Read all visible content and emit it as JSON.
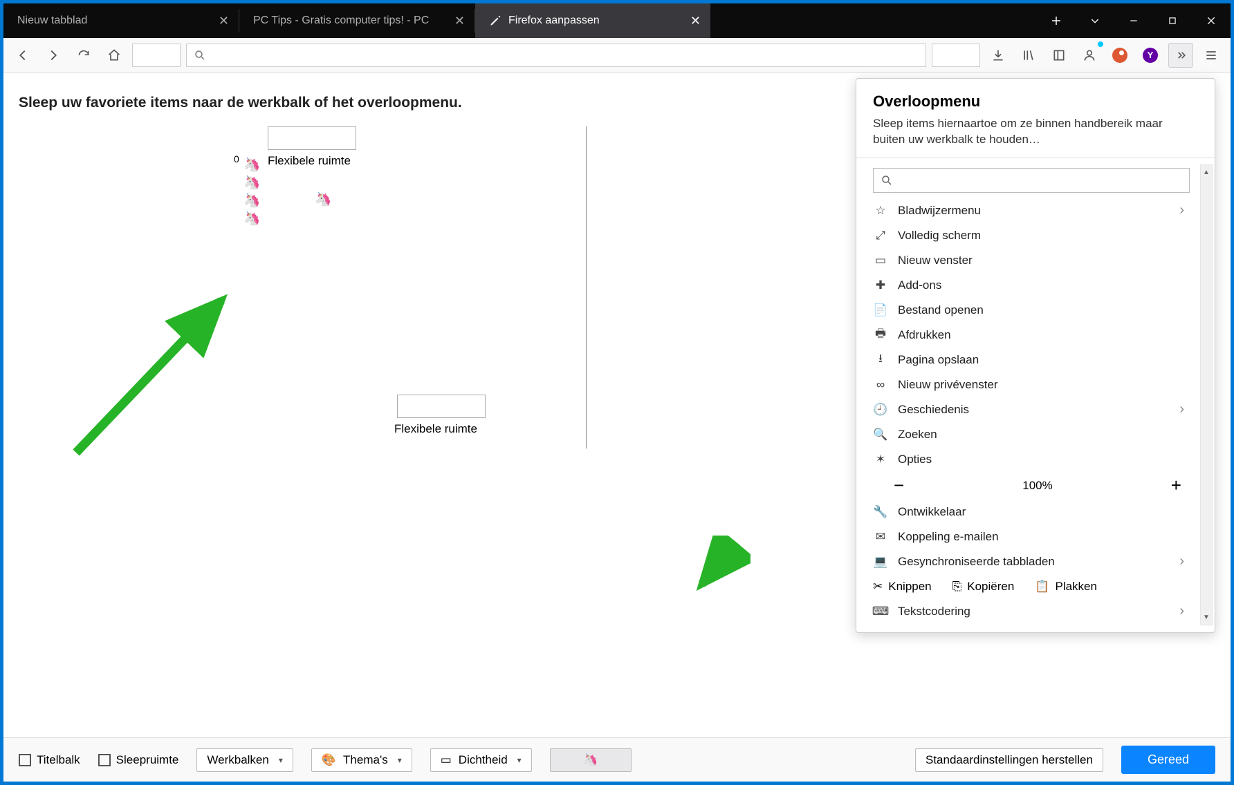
{
  "tabs": [
    {
      "label": "Nieuw tabblad"
    },
    {
      "label": "PC Tips - Gratis computer tips! - PC"
    },
    {
      "label": "Firefox aanpassen"
    }
  ],
  "instruction": "Sleep uw favoriete items naar de werkbalk of het overloopmenu.",
  "palette": {
    "flex1": "Flexibele ruimte",
    "flex2": "Flexibele ruimte",
    "zero": "0"
  },
  "panel": {
    "title": "Overloopmenu",
    "desc": "Sleep items hiernaartoe om ze binnen handbereik maar buiten uw werkbalk te houden…",
    "items": {
      "bookmarks": "Bladwijzermenu",
      "fullscreen": "Volledig scherm",
      "newwindow": "Nieuw venster",
      "addons": "Add-ons",
      "openfile": "Bestand openen",
      "print": "Afdrukken",
      "savepage": "Pagina opslaan",
      "private": "Nieuw privévenster",
      "history": "Geschiedenis",
      "search": "Zoeken",
      "options": "Opties",
      "zoom": "100%",
      "developer": "Ontwikkelaar",
      "email": "Koppeling e-mailen",
      "synced": "Gesynchroniseerde tabbladen",
      "cut": "Knippen",
      "copy": "Kopiëren",
      "paste": "Plakken",
      "encoding": "Tekstcodering"
    }
  },
  "footer": {
    "titelbalk": "Titelbalk",
    "sleepruimte": "Sleepruimte",
    "werkbalken": "Werkbalken",
    "themas": "Thema's",
    "dichtheid": "Dichtheid",
    "reset": "Standaardinstellingen herstellen",
    "done": "Gereed"
  }
}
